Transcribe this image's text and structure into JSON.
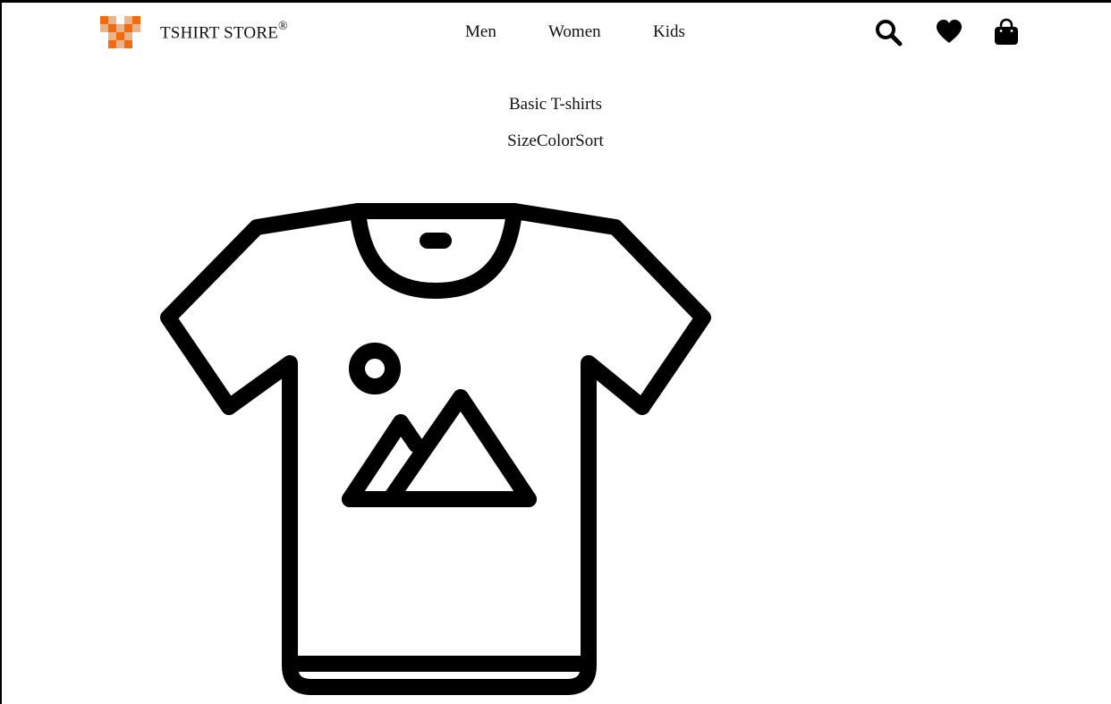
{
  "header": {
    "brand_name": "TSHIRT STORE",
    "brand_mark": "®",
    "logo_icon": "checkered-v-logo",
    "nav": [
      {
        "label": "Men"
      },
      {
        "label": "Women"
      },
      {
        "label": "Kids"
      }
    ],
    "actions": [
      {
        "icon": "search-icon"
      },
      {
        "icon": "heart-icon"
      },
      {
        "icon": "shopping-bag-icon"
      }
    ]
  },
  "main": {
    "category_title": "Basic T-shirts",
    "filters": [
      "Size",
      "Color",
      "Sort"
    ],
    "product_image_icon": "tshirt-image-placeholder-icon"
  },
  "colors": {
    "logo_orange": "#f26b0f",
    "logo_light": "#e9b48a",
    "text": "#111111"
  }
}
